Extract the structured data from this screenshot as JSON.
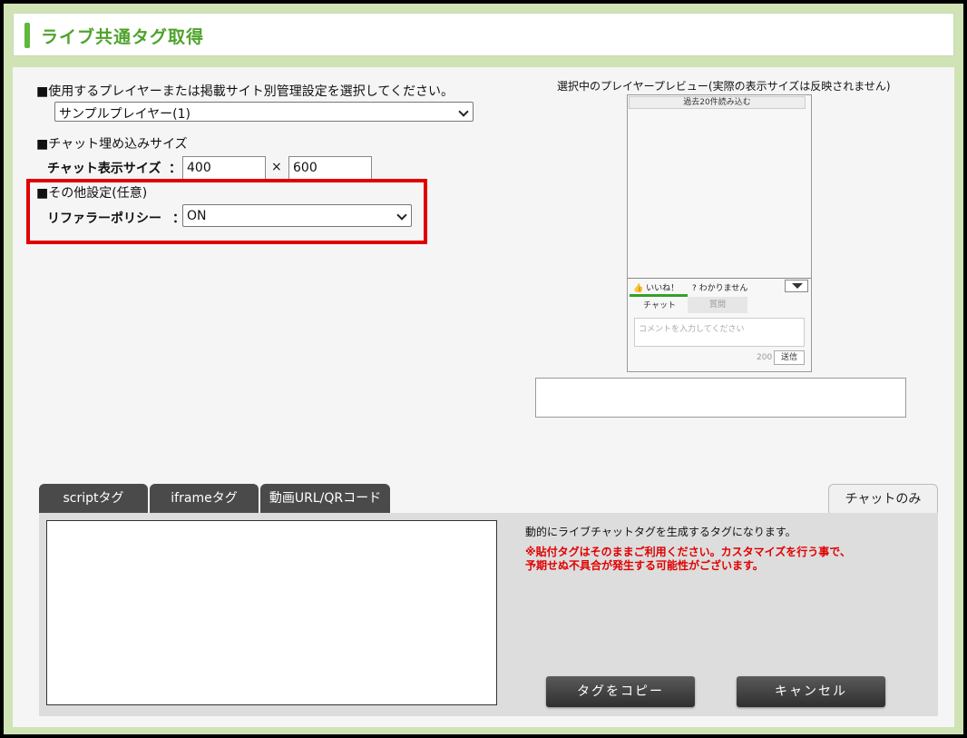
{
  "header": {
    "title": "ライブ共通タグ取得"
  },
  "player_section": {
    "label": "■使用するプレイヤーまたは掲載サイト別管理設定を選択してください。",
    "selected": "サンプルプレイヤー(1)"
  },
  "chat_size_section": {
    "label": "■チャット埋め込みサイズ",
    "row_label": "チャット表示サイズ",
    "colon": "：",
    "width": "400",
    "times": "×",
    "height": "600"
  },
  "other_section": {
    "label": "■その他設定(任意)",
    "row_label": "リファラーポリシー",
    "colon": "：",
    "selected": "ON"
  },
  "preview": {
    "caption": "選択中のプレイヤープレビュー(実際の表示サイズは反映されません)",
    "load_more": "過去20件読み込む",
    "like_label": "いいね！",
    "unknown_label": "わかりません",
    "tab_chat": "チャット",
    "tab_question": "質問",
    "comment_placeholder": "コメントを入力してください",
    "char_count": "200",
    "send_label": "送信"
  },
  "tabs": [
    {
      "label": "scriptタグ"
    },
    {
      "label": "iframeタグ"
    },
    {
      "label": "動画URL/QRコード"
    }
  ],
  "right_tab": {
    "label": "チャットのみ"
  },
  "code_panel": {
    "description": "動的にライブチャットタグを生成するタグになります。",
    "warning_line1": "※貼付タグはそのままご利用ください。カスタマイズを行う事で、",
    "warning_line2": "予期せぬ不具合が発生する可能性がございます。",
    "copy_button": "タグをコピー",
    "cancel_button": "キャンセル"
  },
  "colors": {
    "accent_green": "#4ea32b",
    "frame_green": "#cfe3b4",
    "highlight_red": "#e00000",
    "button_dark": "#3a3a3a"
  }
}
